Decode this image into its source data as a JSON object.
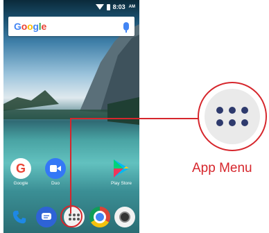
{
  "status_bar": {
    "time": "8:03",
    "ampm": "AM"
  },
  "search": {
    "logo": "Google"
  },
  "apps": [
    {
      "label": "Google",
      "icon": "google-g-icon"
    },
    {
      "label": "Duo",
      "icon": "duo-video-icon"
    },
    {
      "label": "Play Store",
      "icon": "play-store-icon"
    }
  ],
  "dock": [
    {
      "icon": "phone-icon"
    },
    {
      "icon": "messages-icon"
    },
    {
      "icon": "app-menu-grid-icon"
    },
    {
      "icon": "chrome-icon"
    },
    {
      "icon": "camera-icon"
    }
  ],
  "callout": {
    "label": "App Menu"
  },
  "colors": {
    "accent": "#d6262c",
    "grid_dots": "#2e3a6d"
  }
}
